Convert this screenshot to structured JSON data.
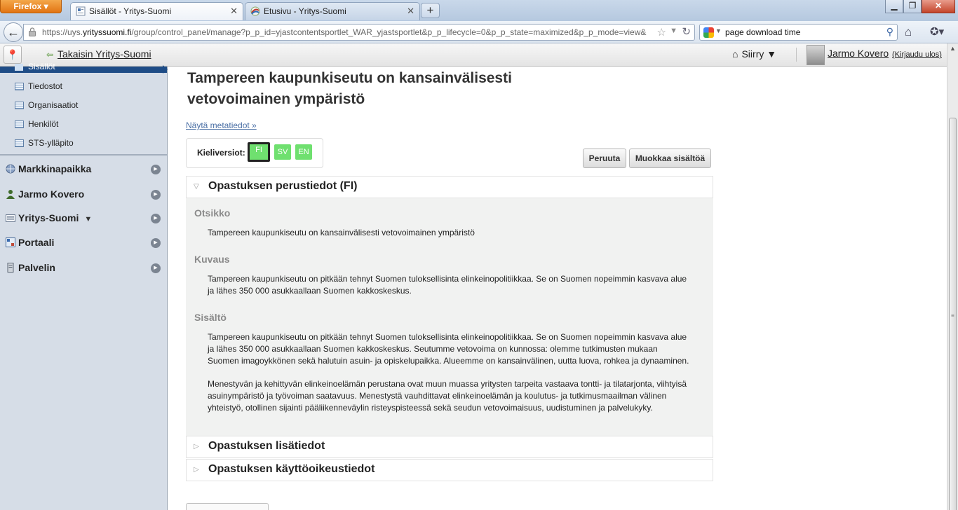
{
  "browser": {
    "app_button": "Firefox",
    "tabs": [
      {
        "title": "Sisällöt - Yritys-Suomi",
        "active": true
      },
      {
        "title": "Etusivu - Yritys-Suomi",
        "active": false
      }
    ],
    "url_prefix": "https://uys.",
    "url_domain": "yrityssuomi.fi",
    "url_rest": "/group/control_panel/manage?p_p_id=yjastcontentsportlet_WAR_yjastsportlet&p_p_lifecycle=0&p_p_state=maximized&p_p_mode=view&",
    "search_query": "page download time"
  },
  "dockbar": {
    "back_label": "Takaisin Yritys-Suomi",
    "goto_label": "Siirry",
    "user_name": "Jarmo Kovero",
    "logout_label": "(Kirjaudu ulos)"
  },
  "sidebar": {
    "active_item": "Sisällöt",
    "sub_items": [
      "Tiedostot",
      "Organisaatiot",
      "Henkilöt",
      "STS-ylläpito"
    ],
    "categories": [
      "Markkinapaikka",
      "Jarmo Kovero",
      "Yritys-Suomi",
      "Portaali",
      "Palvelin"
    ]
  },
  "article": {
    "title": "Tampereen kaupunkiseutu on kansainvälisesti vetovoimainen ympäristö",
    "metadata_link": "Näytä metatiedot »",
    "language_label": "Kieliversiot:",
    "languages": [
      "FI",
      "SV",
      "EN"
    ],
    "active_language": "FI",
    "cancel_button": "Peruuta",
    "edit_button": "Muokkaa sisältöä"
  },
  "panels": {
    "basic_info_title": "Opastuksen perustiedot (FI)",
    "extra_info_title": "Opastuksen lisätiedot",
    "rights_info_title": "Opastuksen käyttöoikeustiedot"
  },
  "fields": {
    "title_label": "Otsikko",
    "title_value": "Tampereen kaupunkiseutu on kansainvälisesti vetovoimainen ympäristö",
    "description_label": "Kuvaus",
    "description_line1": "Tampereen kaupunkiseutu on pitkään tehnyt Suomen tuloksellisinta elinkeinopolitiikkaa. Se on Suomen nopeimmin kasvava alue",
    "description_line2": "ja lähes 350 000 asukkaallaan Suomen kakkoskeskus.",
    "content_label": "Sisältö",
    "content_p1_line1": "Tampereen kaupunkiseutu on pitkään tehnyt Suomen tuloksellisinta elinkeinopolitiikkaa. Se on Suomen nopeimmin kasvava alue",
    "content_p1_line2": "ja lähes 350 000 asukkaallaan Suomen kakkoskeskus. Seutumme vetovoima on kunnossa: olemme tutkimusten mukaan",
    "content_p1_line3": "Suomen imagoykkönen sekä halutuin asuin- ja opiskelupaikka. Alueemme on kansainvälinen, uutta luova, rohkea ja dynaaminen.",
    "content_p2_line1": "Menestyvän ja kehittyvän elinkeinoelämän perustana ovat muun muassa yritysten tarpeita vastaava tontti- ja tilatarjonta, viihtyisä",
    "content_p2_line2": "asuinympäristö ja työvoiman saatavuus. Menestystä vauhdittavat elinkeinoelämän ja koulutus- ja tutkimusmaailman välinen",
    "content_p2_line3": "yhteistyö, otollinen sijainti pääliikenneväylin risteyspisteessä sekä seudun vetovoimaisuus, uudistuminen ja palvelukyky."
  }
}
